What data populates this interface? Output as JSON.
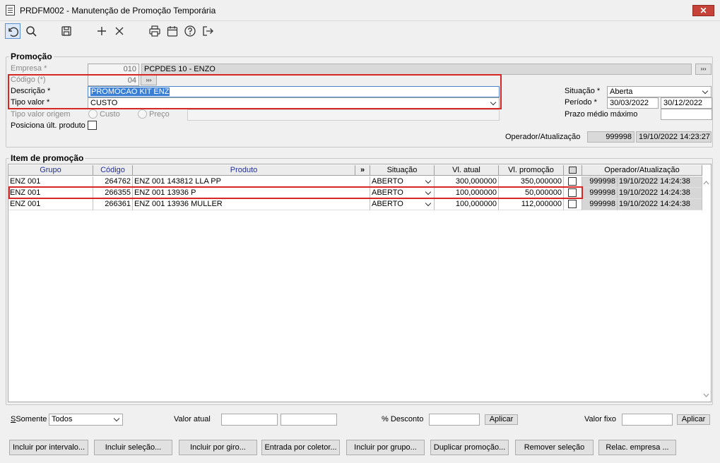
{
  "window": {
    "title": "PRDFM002 - Manutenção de Promoção Temporária",
    "close_glyph": "✕"
  },
  "promocao": {
    "legend": "Promoção",
    "empresa_label": "Empresa *",
    "empresa_code": "010",
    "empresa_name": "PCPDES 10 - ENZO",
    "codigo_label": "Código (*)",
    "codigo_value": "04",
    "descricao_label": "Descrição *",
    "descricao_value": "PROMOCAO KIT ENZ",
    "tipo_valor_label": "Tipo valor *",
    "tipo_valor_value": "CUSTO",
    "tipo_valor_origem_label": "Tipo valor origem",
    "radio_custo": "Custo",
    "radio_preco": "Preço",
    "posiciona_label": "Posiciona últ. produto",
    "situacao_label": "Situação *",
    "situacao_value": "Aberta",
    "periodo_label": "Período *",
    "periodo_inicio": "30/03/2022",
    "periodo_fim": "30/12/2022",
    "prazo_label": "Prazo médio máximo",
    "operador_label": "Operador/Atualização",
    "operador_value": "999998",
    "atualizacao_value": "19/10/2022 14:23:27"
  },
  "item": {
    "legend": "Item de promoção",
    "columns": {
      "grupo": "Grupo",
      "codigo": "Código",
      "produto": "Produto",
      "expand": "»",
      "situacao": "Situação",
      "vl_atual": "Vl. atual",
      "vl_promocao": "Vl. promoção",
      "operador": "Operador/Atualização"
    },
    "rows": [
      {
        "grupo": "ENZ 001",
        "codigo": "264762",
        "produto": "ENZ 001 143812 LLA PP",
        "situacao": "ABERTO",
        "vl_atual": "300,000000",
        "vl_promocao": "350,000000",
        "operador": "999998",
        "data": "19/10/2022 14:24:38"
      },
      {
        "grupo": "ENZ 001",
        "codigo": "266355",
        "produto": "ENZ 001 13936 P",
        "situacao": "ABERTO",
        "vl_atual": "100,000000",
        "vl_promocao": "50,000000",
        "operador": "999998",
        "data": "19/10/2022 14:24:38"
      },
      {
        "grupo": "ENZ 001",
        "codigo": "266361",
        "produto": "ENZ 001 13936 MULLER",
        "situacao": "ABERTO",
        "vl_atual": "100,000000",
        "vl_promocao": "112,000000",
        "operador": "999998",
        "data": "19/10/2022 14:24:38"
      }
    ]
  },
  "filter": {
    "somente_label": "Somente",
    "somente_value": "Todos",
    "valor_atual_label": "Valor atual",
    "desconto_label": "% Desconto",
    "aplicar_label": "Aplicar",
    "valor_fixo_label": "Valor fixo"
  },
  "buttons": [
    "Incluir por intervalo...",
    "Incluir seleção...",
    "Incluir por giro...",
    "Entrada por coletor...",
    "Incluir por grupo...",
    "Duplicar promoção...",
    "Remover seleção",
    "Relac. empresa ..."
  ],
  "toolbar_icons": [
    "undo-icon",
    "search-icon",
    "save-icon",
    "add-icon",
    "delete-icon",
    "print-icon",
    "calendar-icon",
    "help-icon",
    "exit-icon"
  ],
  "colors": {
    "highlight_red": "#d72626",
    "selection_blue": "#3a7fd6",
    "header_blue": "#1f2fa5"
  }
}
